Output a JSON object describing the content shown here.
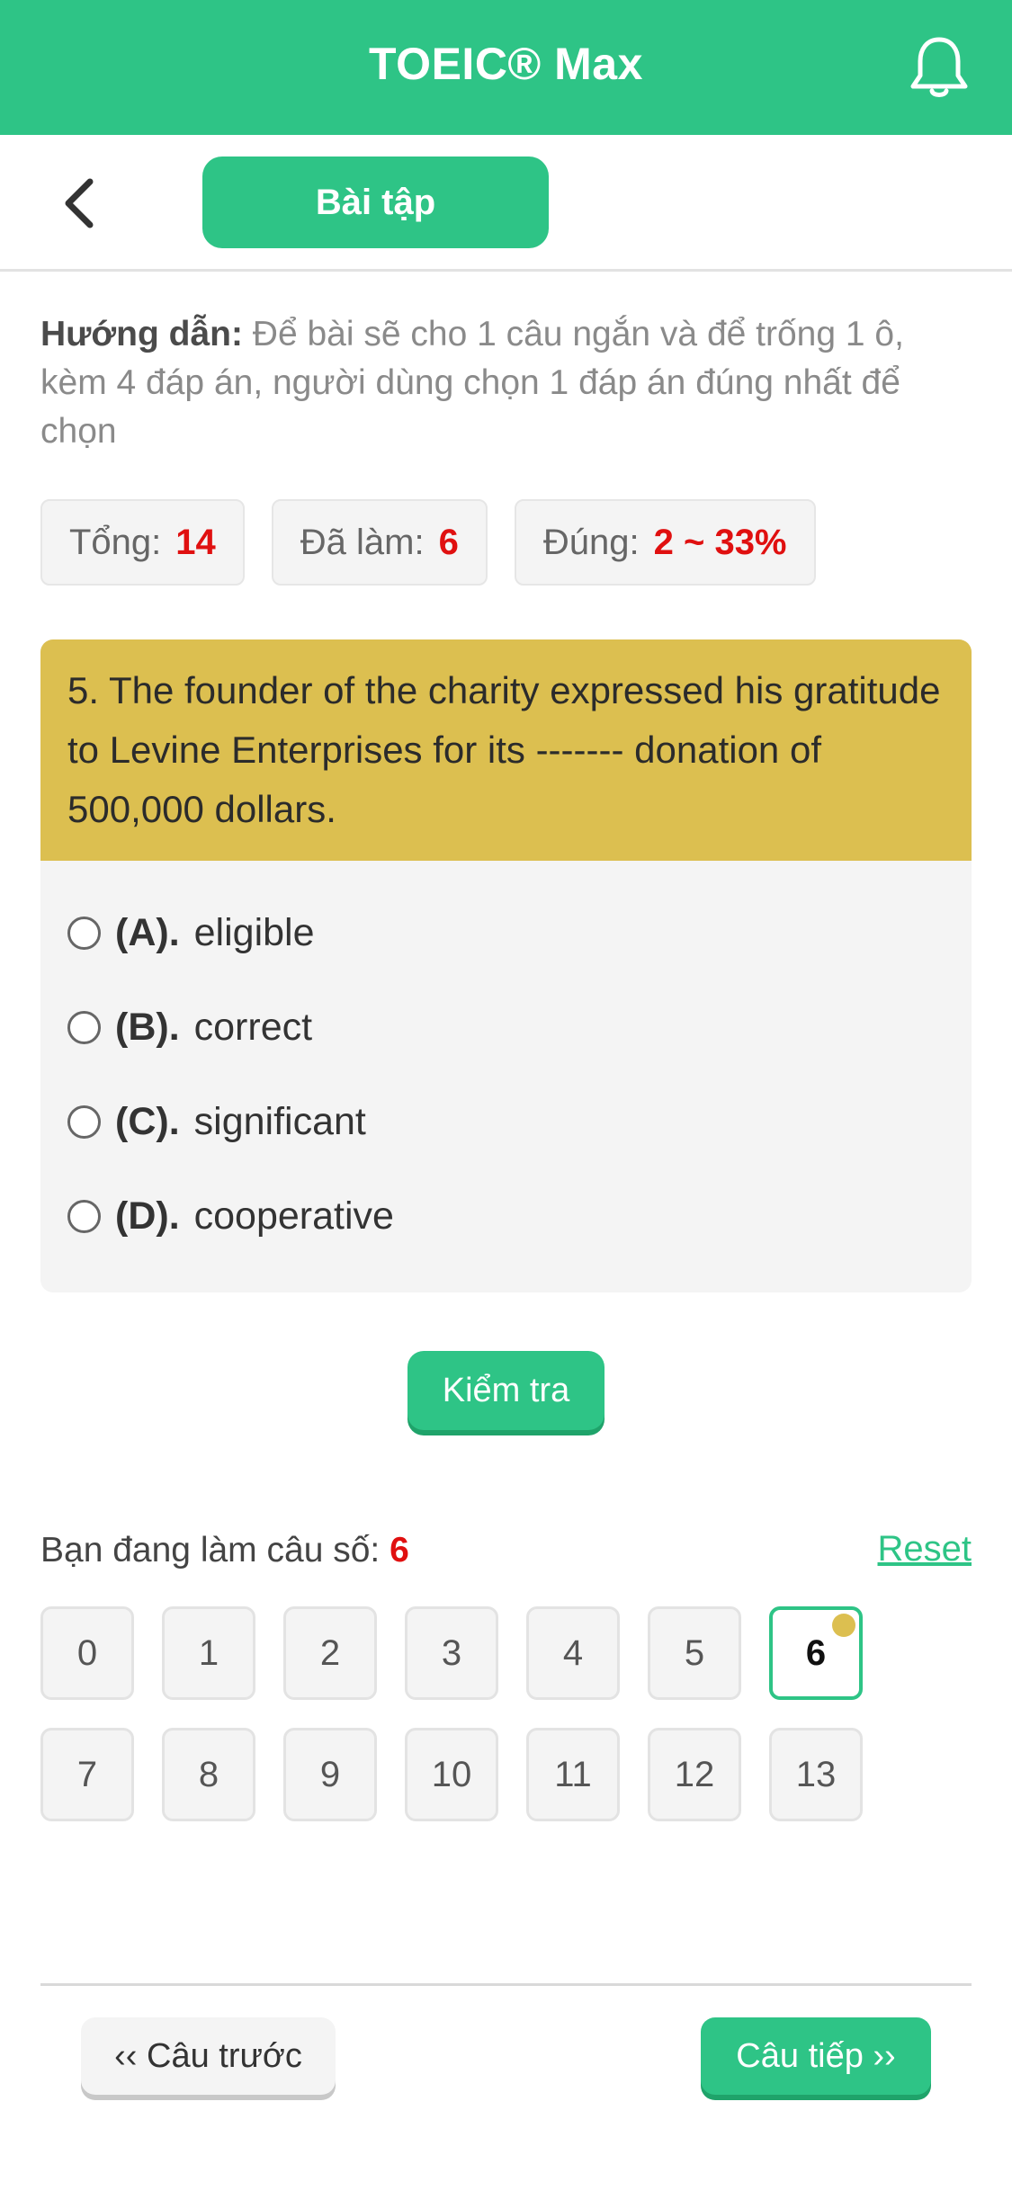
{
  "header": {
    "title": "TOEIC® Max",
    "bell_icon": "bell-icon"
  },
  "subheader": {
    "back_icon": "chevron-left-icon",
    "tab_label": "Bài tập"
  },
  "guide": {
    "label": "Hướng dẫn:",
    "text": "Để bài sẽ cho 1 câu ngắn và để trống 1 ô, kèm 4 đáp án, người dùng chọn 1 đáp án đúng nhất để chọn"
  },
  "stats": [
    {
      "label": "Tổng:",
      "value": "14"
    },
    {
      "label": "Đã làm:",
      "value": "6"
    },
    {
      "label": "Đúng:",
      "value": "2 ~ 33%"
    }
  ],
  "question": {
    "text": "5. The founder of the charity expressed his gratitude to Levine Enterprises for its ------- donation of 500,000 dollars.",
    "options": [
      {
        "letter": "(A).",
        "text": "eligible"
      },
      {
        "letter": "(B).",
        "text": "correct"
      },
      {
        "letter": "(C).",
        "text": "significant"
      },
      {
        "letter": "(D).",
        "text": "cooperative"
      }
    ]
  },
  "check_button": "Kiểm tra",
  "progress": {
    "label": "Bạn đang làm câu số:",
    "current": "6",
    "reset": "Reset",
    "numbers": [
      "0",
      "1",
      "2",
      "3",
      "4",
      "5",
      "6",
      "7",
      "8",
      "9",
      "10",
      "11",
      "12",
      "13"
    ]
  },
  "footer": {
    "prev": "‹‹ Câu trước",
    "next": "Câu tiếp ››"
  },
  "colors": {
    "primary": "#2ec486",
    "question_bg": "#dcbf50",
    "highlight": "#e01010"
  }
}
